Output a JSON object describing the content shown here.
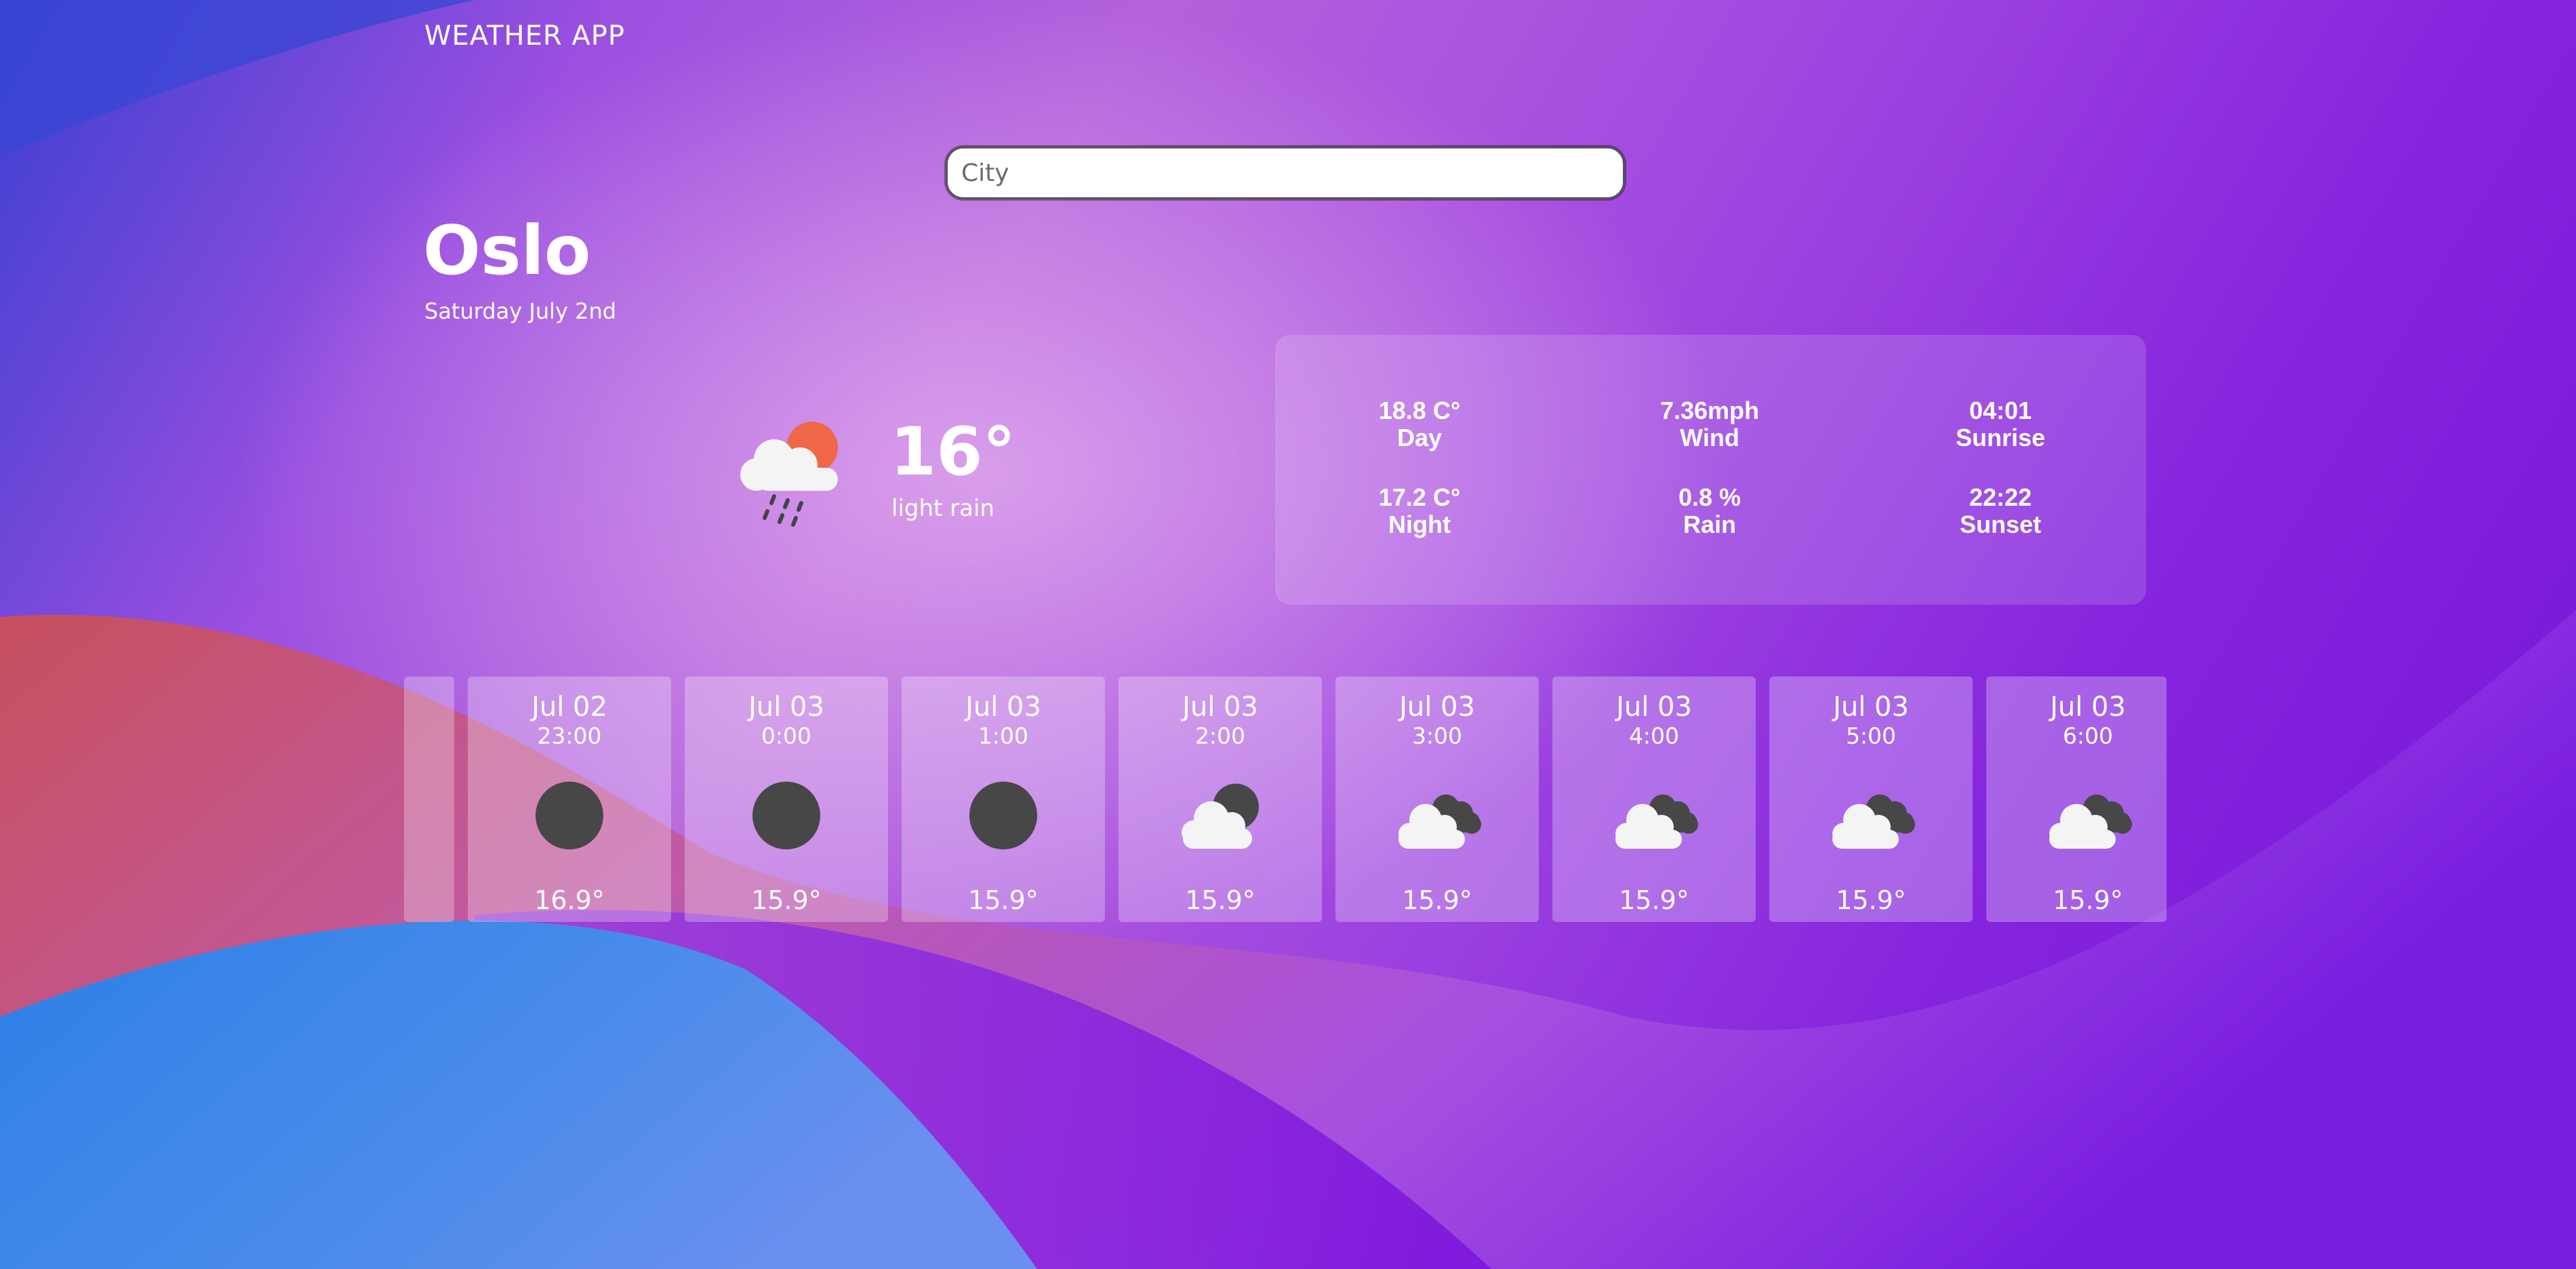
{
  "app": {
    "title": "WEATHER APP"
  },
  "search": {
    "placeholder": "City"
  },
  "location": {
    "city": "Oslo",
    "date": "Saturday July 2nd"
  },
  "current": {
    "temp": "16°",
    "description": "light rain",
    "icon": "cloud-sun-rain-icon"
  },
  "stats": [
    {
      "value": "18.8 C°",
      "label": "Day"
    },
    {
      "value": "7.36mph",
      "label": "Wind"
    },
    {
      "value": "04:01",
      "label": "Sunrise"
    },
    {
      "value": "17.2 C°",
      "label": "Night"
    },
    {
      "value": "0.8 %",
      "label": "Rain"
    },
    {
      "value": "22:22",
      "label": "Sunset"
    }
  ],
  "forecast": [
    {
      "date": "Jul 02",
      "time": "23:00",
      "icon": "moon-icon",
      "temp": "16.9°"
    },
    {
      "date": "Jul 03",
      "time": "0:00",
      "icon": "moon-icon",
      "temp": "15.9°"
    },
    {
      "date": "Jul 03",
      "time": "1:00",
      "icon": "moon-icon",
      "temp": "15.9°"
    },
    {
      "date": "Jul 03",
      "time": "2:00",
      "icon": "cloud-moon-icon",
      "temp": "15.9°"
    },
    {
      "date": "Jul 03",
      "time": "3:00",
      "icon": "cloud-dark-cloud-icon",
      "temp": "15.9°"
    },
    {
      "date": "Jul 03",
      "time": "4:00",
      "icon": "cloud-dark-cloud-icon",
      "temp": "15.9°"
    },
    {
      "date": "Jul 03",
      "time": "5:00",
      "icon": "cloud-dark-cloud-icon",
      "temp": "15.9°"
    },
    {
      "date": "Jul 03",
      "time": "6:00",
      "icon": "cloud-dark-cloud-icon",
      "temp": "15.9°"
    }
  ]
}
